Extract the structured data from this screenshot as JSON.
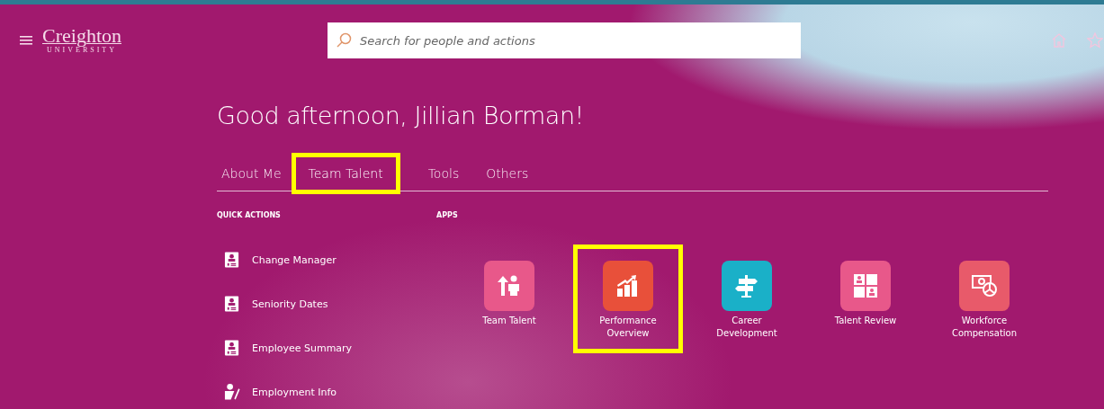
{
  "header": {
    "logo": {
      "name": "Creighton",
      "subtitle": "UNIVERSITY"
    },
    "search": {
      "placeholder": "Search for people and actions"
    }
  },
  "greeting": "Good afternoon, Jillian Borman!",
  "tabs": [
    {
      "label": "About Me",
      "selected": false,
      "highlighted": false
    },
    {
      "label": "Team Talent",
      "selected": true,
      "highlighted": true
    },
    {
      "label": "Tools",
      "selected": false,
      "highlighted": false
    },
    {
      "label": "Others",
      "selected": false,
      "highlighted": false
    }
  ],
  "quick_actions": {
    "heading": "QUICK ACTIONS",
    "items": [
      {
        "label": "Change Manager",
        "kind": "badge"
      },
      {
        "label": "Seniority Dates",
        "kind": "badge"
      },
      {
        "label": "Employee Summary",
        "kind": "badge"
      },
      {
        "label": "Employment Info",
        "kind": "edit"
      }
    ]
  },
  "apps": {
    "heading": "APPS",
    "items": [
      {
        "label": "Team Talent",
        "kind": "team",
        "color": "#e8588a",
        "highlighted": false
      },
      {
        "label": "Performance Overview",
        "kind": "chart",
        "color": "#e8503a",
        "highlighted": true
      },
      {
        "label": "Career Development",
        "kind": "sign",
        "color": "#1ab0c8",
        "highlighted": false
      },
      {
        "label": "Talent Review",
        "kind": "grid",
        "color": "#e8588a",
        "highlighted": false
      },
      {
        "label": "Workforce Compensation",
        "kind": "money",
        "color": "#e85a6a",
        "highlighted": false
      }
    ]
  }
}
